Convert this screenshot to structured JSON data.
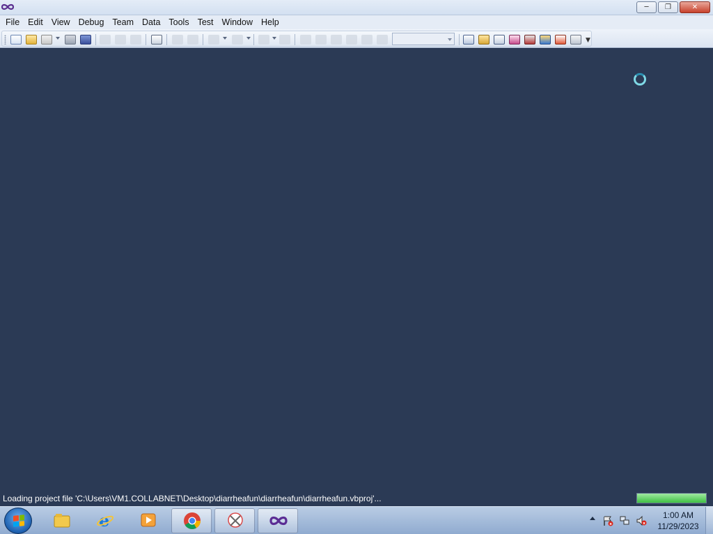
{
  "window": {
    "app_icon": "visual-studio-infinity-icon",
    "buttons": {
      "minimize": "minimize-icon",
      "restore": "restore-icon",
      "close": "close-icon"
    }
  },
  "menu": {
    "items": [
      "File",
      "Edit",
      "View",
      "Debug",
      "Team",
      "Data",
      "Tools",
      "Test",
      "Window",
      "Help"
    ]
  },
  "toolbar": {
    "solution_config_value": "",
    "icons": [
      "new-project-icon",
      "open-file-icon",
      "add-item-icon",
      "save-icon",
      "save-all-icon",
      "cut-icon",
      "copy-icon",
      "paste-icon",
      "find-icon",
      "comment-icon",
      "uncomment-icon",
      "undo-icon",
      "redo-icon",
      "navigate-backward-icon",
      "navigate-forward-icon",
      "start-debugging-icon",
      "break-all-icon",
      "stop-debugging-icon",
      "step-into-icon",
      "step-over-icon",
      "step-out-icon",
      "find-in-files-icon",
      "solution-explorer-icon",
      "properties-icon",
      "object-browser-icon",
      "toolbox-icon",
      "team-explorer-icon",
      "error-list-icon",
      "start-page-icon",
      "toolbar-options-icon"
    ]
  },
  "status": {
    "text": "Loading project file 'C:\\Users\\VM1.COLLABNET\\Desktop\\diarrheafun\\diarrheafun\\diarrheafun.vbproj'...",
    "progress_fraction": 1.0
  },
  "taskbar": {
    "start_icon": "windows-start-icon",
    "apps": [
      "file-explorer-icon",
      "internet-explorer-icon",
      "media-player-icon",
      "chrome-icon",
      "snipping-tool-icon",
      "visual-studio-icon"
    ],
    "tray_icons": [
      "show-hidden-icons-icon",
      "action-center-icon",
      "network-icon",
      "volume-muted-icon"
    ],
    "time": "1:00 AM",
    "date": "11/29/2023"
  },
  "colors": {
    "workspace": "#2b3a55",
    "titlebar": "#dde6f3",
    "progress": "#4cc44f",
    "spinner": "#7fd9e6"
  }
}
